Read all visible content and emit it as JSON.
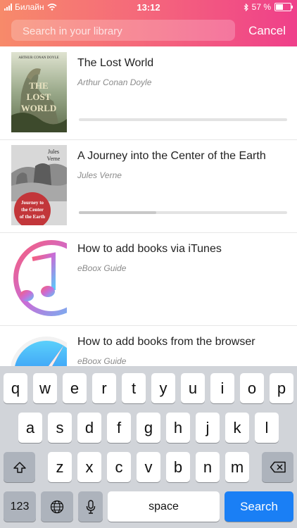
{
  "status_bar": {
    "carrier": "Билайн",
    "time": "13:12",
    "battery": "57 %",
    "battery_level": 0.57,
    "icons": [
      "signal-bars-icon",
      "wifi-icon",
      "bluetooth-icon",
      "battery-icon"
    ]
  },
  "search": {
    "placeholder": "Search in your library",
    "value": "",
    "cancel_label": "Cancel"
  },
  "books": [
    {
      "title": "The Lost World",
      "author": "Arthur Conan Doyle",
      "progress": 0.0,
      "cover_text": [
        "ARTHUR CONAN DOYLE",
        "THE",
        "LOST",
        "WORLD"
      ]
    },
    {
      "title": "A Journey into the Center of the Earth",
      "author": "Jules Verne",
      "progress": 0.37,
      "cover_text": [
        "Jules",
        "Verne",
        "Journey to",
        "the Center",
        "of the Earth"
      ]
    },
    {
      "title": "How to add books via iTunes",
      "author": "eBoox Guide"
    },
    {
      "title": "How to add books from the browser",
      "author": "eBoox Guide"
    }
  ],
  "keyboard": {
    "row1": [
      "q",
      "w",
      "e",
      "r",
      "t",
      "y",
      "u",
      "i",
      "o",
      "p"
    ],
    "row2": [
      "a",
      "s",
      "d",
      "f",
      "g",
      "h",
      "j",
      "k",
      "l"
    ],
    "row3": [
      "z",
      "x",
      "c",
      "v",
      "b",
      "n",
      "m"
    ],
    "numbers_label": "123",
    "space_label": "space",
    "search_label": "Search",
    "icons": [
      "shift-icon",
      "backspace-icon",
      "globe-icon",
      "microphone-icon"
    ]
  },
  "colors": {
    "header_gradient_start": "#f78a6a",
    "header_gradient_end": "#ef3f8a",
    "search_key": "#1a7ff5",
    "keyboard_bg": "#d1d4d9"
  }
}
